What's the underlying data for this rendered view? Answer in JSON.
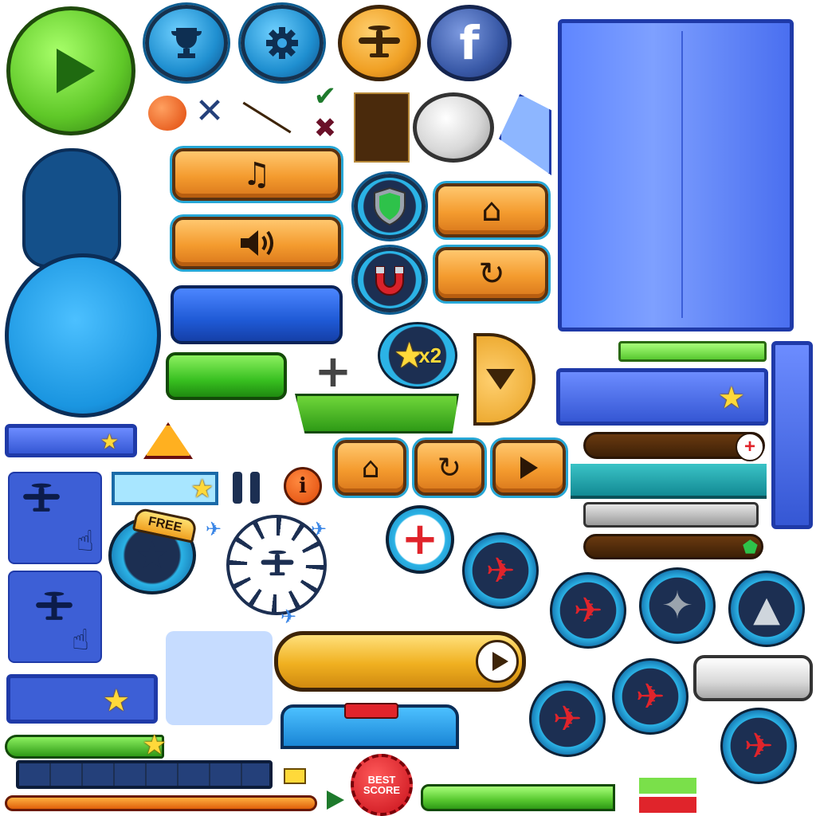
{
  "buttons": {
    "facebook_letter": "f",
    "free_badge": "FREE",
    "x2_badge": "x2",
    "best_score_line1": "BEST",
    "best_score_line2": "SCORE"
  },
  "icons": {
    "play": "play-icon",
    "trophy": "trophy-icon",
    "settings": "gear-icon",
    "plane": "plane-icon",
    "facebook": "facebook-icon",
    "music": "music-icon",
    "sound": "sound-icon",
    "home": "home-icon",
    "restart": "restart-icon",
    "shield": "shield-icon",
    "magnet": "magnet-icon",
    "pause": "pause-icon",
    "info": "info-icon",
    "add_health": "plus-icon",
    "star": "star-icon"
  },
  "colors": {
    "green": "#6fd63a",
    "blue": "#1f8fd0",
    "orange": "#f49b2e",
    "panel_blue": "#4b6df0",
    "red": "#e0242b"
  },
  "progress": {
    "bottom_bar_fill": 1.0,
    "green_bar_fill": 1.0,
    "brown_bar_fill": 0.0
  }
}
